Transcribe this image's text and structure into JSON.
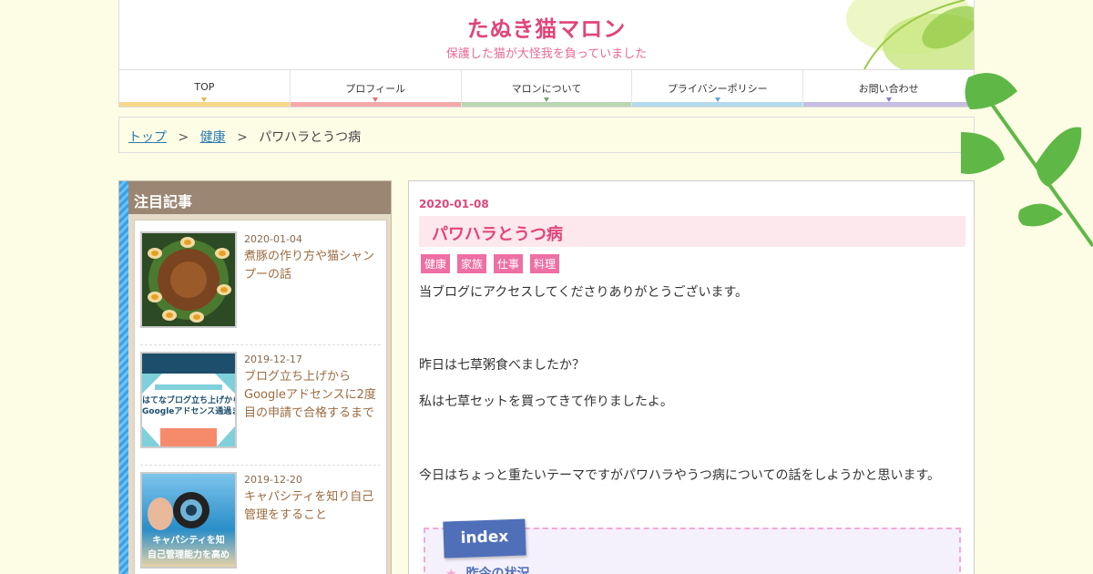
{
  "header": {
    "title": "たぬき猫マロン",
    "subtitle": "保護した猫が大怪我を負っていました"
  },
  "nav": {
    "items": [
      {
        "label": "TOP",
        "color": "#f7d88a"
      },
      {
        "label": "プロフィール",
        "color": "#f4a9a8"
      },
      {
        "label": "マロンについて",
        "color": "#b9d6b0"
      },
      {
        "label": "プライバシーポリシー",
        "color": "#b5d9ec"
      },
      {
        "label": "お問い合わせ",
        "color": "#c6bde3"
      }
    ]
  },
  "breadcrumb": {
    "home": "トップ",
    "category": "健康",
    "current": "パワハラとうつ病",
    "separator": ">"
  },
  "sidebar": {
    "heading": "注目記事",
    "posts": [
      {
        "date": "2020-01-04",
        "title": "煮豚の作り方や猫シャンプーの話"
      },
      {
        "date": "2019-12-17",
        "title": "ブログ立ち上げからGoogleアドセンスに2度目の申請で合格するまで"
      },
      {
        "date": "2019-12-20",
        "title": "キャパシティを知り自己管理をすること"
      }
    ],
    "thumb2": {
      "line1": "はてなブログ立ち上げから",
      "line2": "Googleアドセンス通過まで"
    },
    "thumb3": {
      "line1": "キャパシティを知",
      "line2": "自己管理能力を高め"
    }
  },
  "article": {
    "date": "2020-01-08",
    "title": "パワハラとうつ病",
    "tags": [
      "健康",
      "家族",
      "仕事",
      "料理"
    ],
    "paragraphs": [
      "当ブログにアクセスしてくださりありがとうございます。",
      "昨日は七草粥食べましたか？",
      "私は七草セットを買ってきて作りましたよ。",
      "今日はちょっと重たいテーマですがパワハラやうつ病についての話をしようかと思います。"
    ],
    "index_label": "index",
    "index_first": "昨今の状況"
  }
}
